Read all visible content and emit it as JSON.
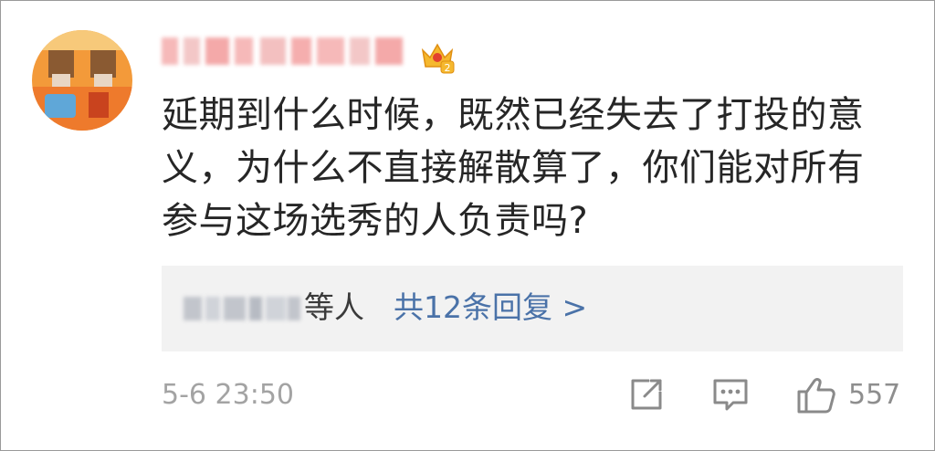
{
  "comment": {
    "text": "延期到什么时候，既然已经失去了打投的意义，为什么不直接解散算了，你们能对所有参与这场选秀的人负责吗?",
    "timestamp": "5-6 23:50",
    "like_count": "557"
  },
  "replies": {
    "suffix": "等人",
    "link_label": "共12条回复 >"
  },
  "icons": {
    "share": "share-icon",
    "comment": "comment-icon",
    "like": "thumbs-up-icon",
    "vip": "vip-crown-badge-icon"
  },
  "colors": {
    "link": "#4a72a8",
    "text": "#262626",
    "meta": "#a3a3a3",
    "reply_bg": "#f2f2f2"
  }
}
